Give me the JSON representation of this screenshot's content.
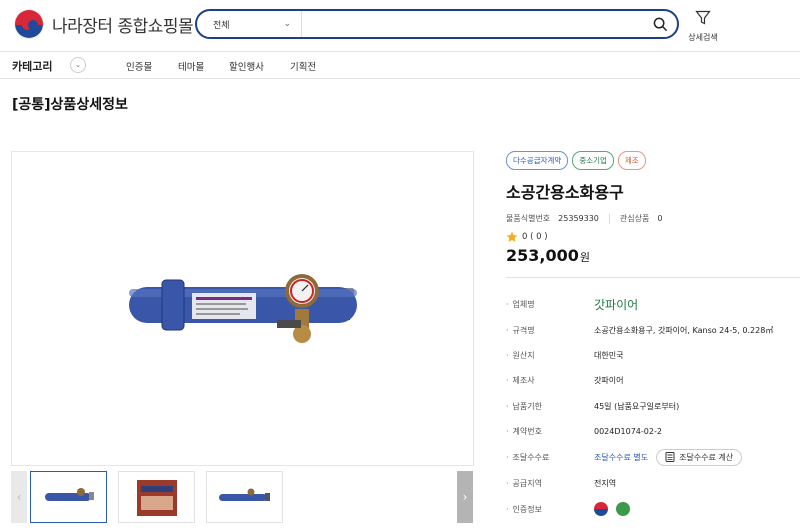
{
  "header": {
    "logo_text": "나라장터 종합쇼핑몰",
    "search_category": "전체",
    "search_placeholder": "",
    "detail_search_label": "상세검색"
  },
  "nav": {
    "category_label": "카테고리",
    "items": [
      "인증몰",
      "테마몰",
      "할인행사",
      "기획전"
    ]
  },
  "page_title": "[공통]상품상세정보",
  "product": {
    "badges": [
      "다수공급자계약",
      "중소기업",
      "제조"
    ],
    "name": "소공간용소화용구",
    "id_label": "물품식별번호",
    "id_value": "25359330",
    "interest_label": "관심상품",
    "interest_value": "0",
    "rating": "0 ( 0 )",
    "price": "253,000",
    "price_unit": "원"
  },
  "specs": [
    {
      "label": "업체명",
      "value": "갓파이어"
    },
    {
      "label": "규격명",
      "value": "소공간용소화용구, 갓파이어, Kanso 24-5, 0.228㎥"
    },
    {
      "label": "원산지",
      "value": "대한민국"
    },
    {
      "label": "제조사",
      "value": "갓파이어"
    },
    {
      "label": "납품기한",
      "value": "45일 (납품요구일로부터)"
    },
    {
      "label": "계약번호",
      "value": "0024D1074-02-2"
    },
    {
      "label": "조달수수료",
      "value": "조달수수료 별도",
      "button": "조달수수료 계산"
    },
    {
      "label": "공급지역",
      "value": "전지역"
    },
    {
      "label": "인증정보",
      "value": ""
    }
  ],
  "colors": {
    "accent": "#1d3f8a",
    "supplier": "#1e7a45",
    "link": "#2a5cb8",
    "product_blue": "#3a56a8"
  }
}
